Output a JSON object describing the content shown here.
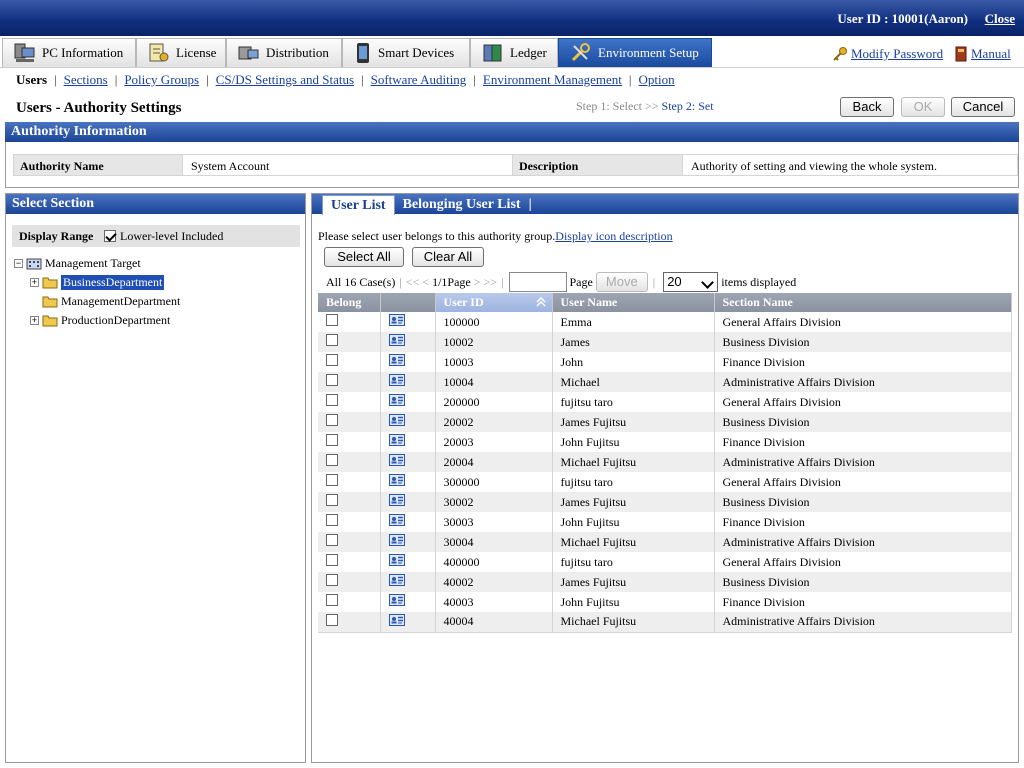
{
  "topbar": {
    "user_id": "User ID : 10001(Aaron)",
    "close": "Close"
  },
  "tabs": [
    {
      "label": "PC Information",
      "icon": "pc-icon"
    },
    {
      "label": "License",
      "icon": "license-icon"
    },
    {
      "label": "Distribution",
      "icon": "distribution-icon"
    },
    {
      "label": "Smart Devices",
      "icon": "smart-device-icon"
    },
    {
      "label": "Ledger",
      "icon": "ledger-icon"
    },
    {
      "label": "Environment Setup",
      "icon": "wrench-icon",
      "active": true
    }
  ],
  "toplinks": {
    "modify_password": "Modify Password",
    "manual": "Manual"
  },
  "subnav": {
    "current": "Users",
    "items": [
      "Sections",
      "Policy Groups",
      "CS/DS Settings and Status",
      "Software Auditing",
      "Environment Management",
      "Option"
    ]
  },
  "page": {
    "title": "Users - Authority Settings",
    "step1": "Step 1: Select >>",
    "step2": "Step 2: Set"
  },
  "buttons": {
    "back": "Back",
    "ok": "OK",
    "cancel": "Cancel"
  },
  "authority": {
    "header": "Authority Information",
    "name_label": "Authority Name",
    "name_value": "System Account",
    "desc_label": "Description",
    "desc_value": "Authority of setting and viewing the whole system."
  },
  "section": {
    "header": "Select Section",
    "display_range": "Display Range",
    "lower_level": "Lower-level Included",
    "tree": {
      "root": "Management Target",
      "children": [
        "BusinessDepartment",
        "ManagementDepartment",
        "ProductionDepartment"
      ]
    }
  },
  "right": {
    "tab_user_list": "User List",
    "tab_belonging": "Belonging User List",
    "instruction": "Please select user belongs to this authority group.",
    "icon_desc": "Display icon description",
    "select_all": "Select All",
    "clear_all": "Clear All",
    "pager": {
      "count": "All 16 Case(s)",
      "first": "<<",
      "prev": "<",
      "page_info": "1/1Page",
      "next": ">",
      "last": ">>",
      "page_label": "Page",
      "move": "Move",
      "per_page": "20",
      "items_displayed": "items displayed"
    },
    "columns": [
      "Belong",
      "",
      "User ID",
      "User Name",
      "Section Name"
    ],
    "rows": [
      {
        "id": "100000",
        "name": "Emma",
        "section": "General Affairs Division"
      },
      {
        "id": "10002",
        "name": "James",
        "section": "Business Division"
      },
      {
        "id": "10003",
        "name": "John",
        "section": "Finance Division"
      },
      {
        "id": "10004",
        "name": "Michael",
        "section": "Administrative Affairs Division"
      },
      {
        "id": "200000",
        "name": "fujitsu taro",
        "section": "General Affairs Division"
      },
      {
        "id": "20002",
        "name": "James Fujitsu",
        "section": "Business Division"
      },
      {
        "id": "20003",
        "name": "John Fujitsu",
        "section": "Finance Division"
      },
      {
        "id": "20004",
        "name": "Michael Fujitsu",
        "section": "Administrative Affairs Division"
      },
      {
        "id": "300000",
        "name": "fujitsu taro",
        "section": "General Affairs Division"
      },
      {
        "id": "30002",
        "name": "James Fujitsu",
        "section": "Business Division"
      },
      {
        "id": "30003",
        "name": "John Fujitsu",
        "section": "Finance Division"
      },
      {
        "id": "30004",
        "name": "Michael Fujitsu",
        "section": "Administrative Affairs Division"
      },
      {
        "id": "400000",
        "name": "fujitsu taro",
        "section": "General Affairs Division"
      },
      {
        "id": "40002",
        "name": "James Fujitsu",
        "section": "Business Division"
      },
      {
        "id": "40003",
        "name": "John Fujitsu",
        "section": "Finance Division"
      },
      {
        "id": "40004",
        "name": "Michael Fujitsu",
        "section": "Administrative Affairs Division"
      }
    ]
  }
}
